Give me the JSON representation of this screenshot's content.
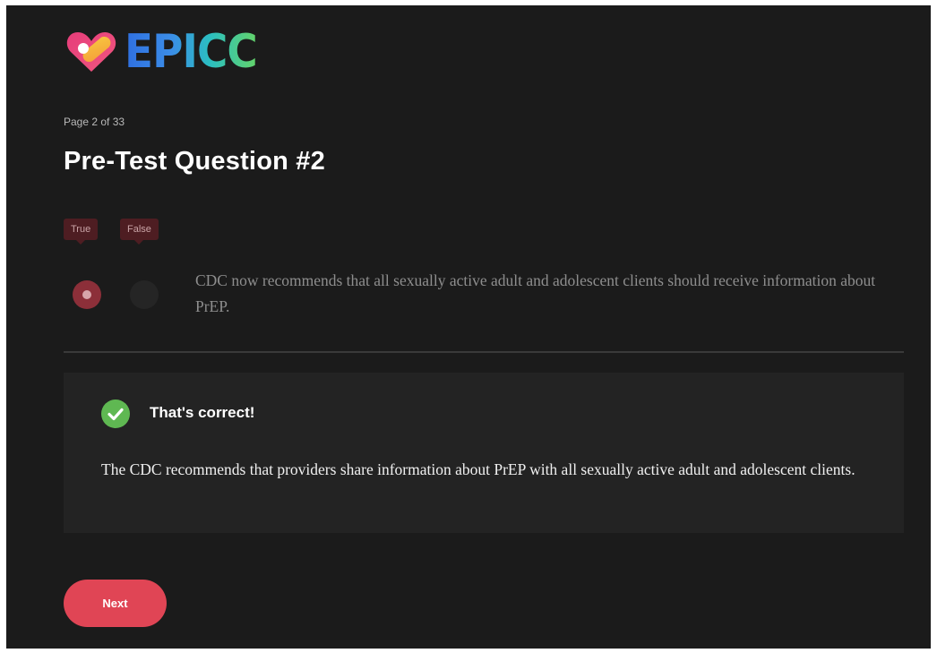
{
  "brand": {
    "name": "EPICC",
    "logo_icon": "heart-bandage-icon"
  },
  "progress": {
    "label": "Page 2 of 33",
    "current": 2,
    "total": 33
  },
  "question": {
    "title": "Pre-Test Question #2",
    "options": {
      "true_label": "True",
      "false_label": "False"
    },
    "selected": "True",
    "statement": "CDC now recommends that all sexually active adult and adolescent clients should receive information about PrEP."
  },
  "feedback": {
    "icon": "check-circle-icon",
    "title": "That's correct!",
    "text": "The CDC recommends that providers share information about PrEP with all sexually active adult and adolescent clients."
  },
  "actions": {
    "next_label": "Next"
  },
  "colors": {
    "background": "#1b1b1b",
    "accent": "#e04555",
    "selected_radio": "#8c2f39",
    "success": "#5fb852"
  }
}
